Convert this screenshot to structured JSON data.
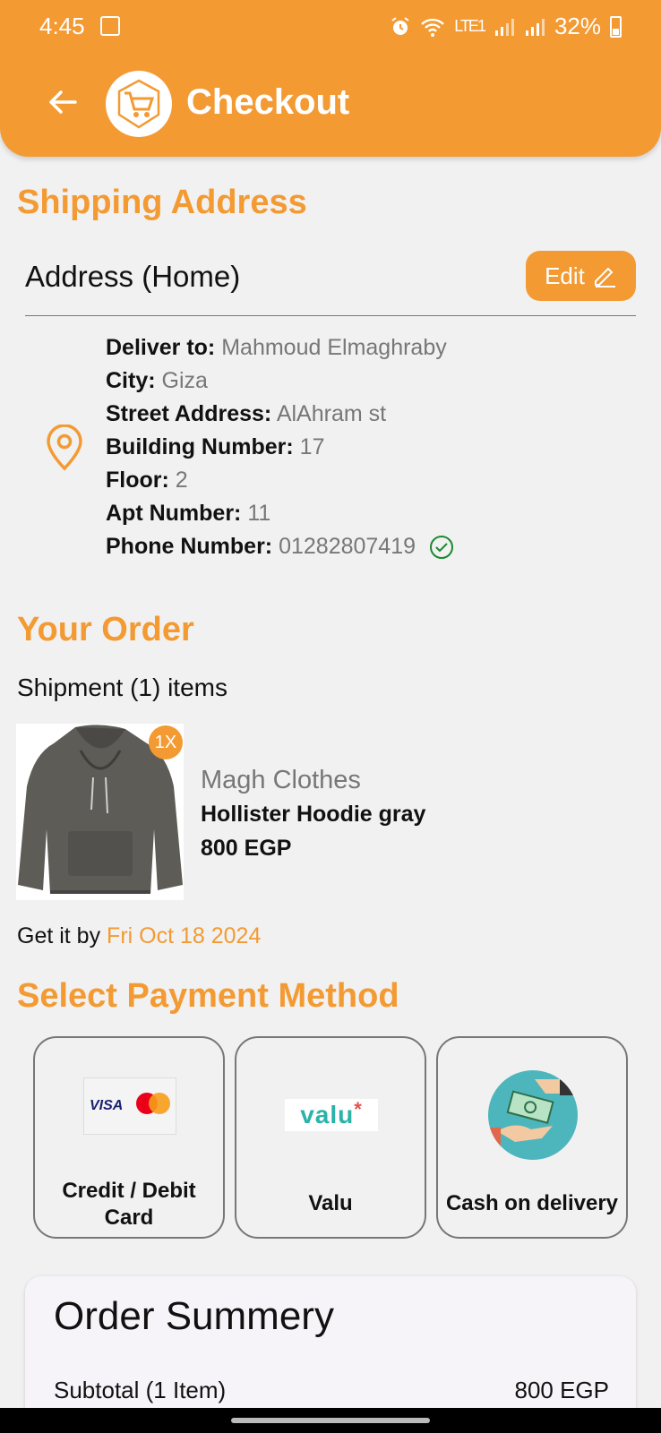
{
  "status_bar": {
    "time": "4:45",
    "battery": "32%",
    "network": "LTE1"
  },
  "header": {
    "title": "Checkout"
  },
  "shipping": {
    "section_title": "Shipping Address",
    "address_label": "Address (Home)",
    "edit_label": "Edit",
    "fields": [
      {
        "key": "Deliver to:",
        "value": "Mahmoud Elmaghraby"
      },
      {
        "key": "City:",
        "value": "Giza"
      },
      {
        "key": "Street Address:",
        "value": "AlAhram st"
      },
      {
        "key": "Building Number:",
        "value": "17"
      },
      {
        "key": "Floor:",
        "value": "2"
      },
      {
        "key": "Apt Number:",
        "value": "11"
      },
      {
        "key": "Phone Number:",
        "value": "01282807419"
      }
    ]
  },
  "order": {
    "section_title": "Your Order",
    "shipment_label": "Shipment (1) items",
    "item": {
      "quantity": "1X",
      "brand": "Magh Clothes",
      "name": "Hollister Hoodie gray",
      "price": "800 EGP"
    },
    "delivery_prefix": "Get it by",
    "delivery_date": "Fri Oct 18 2024"
  },
  "payment": {
    "section_title": "Select Payment Method",
    "methods": [
      {
        "label": "Credit / Debit Card",
        "icon": "visa-mastercard-icon"
      },
      {
        "label": "Valu",
        "icon": "valu-logo"
      },
      {
        "label": "Cash on delivery",
        "icon": "cash-hand-icon"
      }
    ],
    "visa_text": "VISA",
    "valu_text": "valu",
    "valu_star": "*"
  },
  "summary": {
    "title": "Order Summery",
    "subtotal_label": "Subtotal (1 Item)",
    "subtotal_value": "800 EGP"
  },
  "colors": {
    "accent": "#f39a33",
    "verified": "#1a8a2e"
  }
}
